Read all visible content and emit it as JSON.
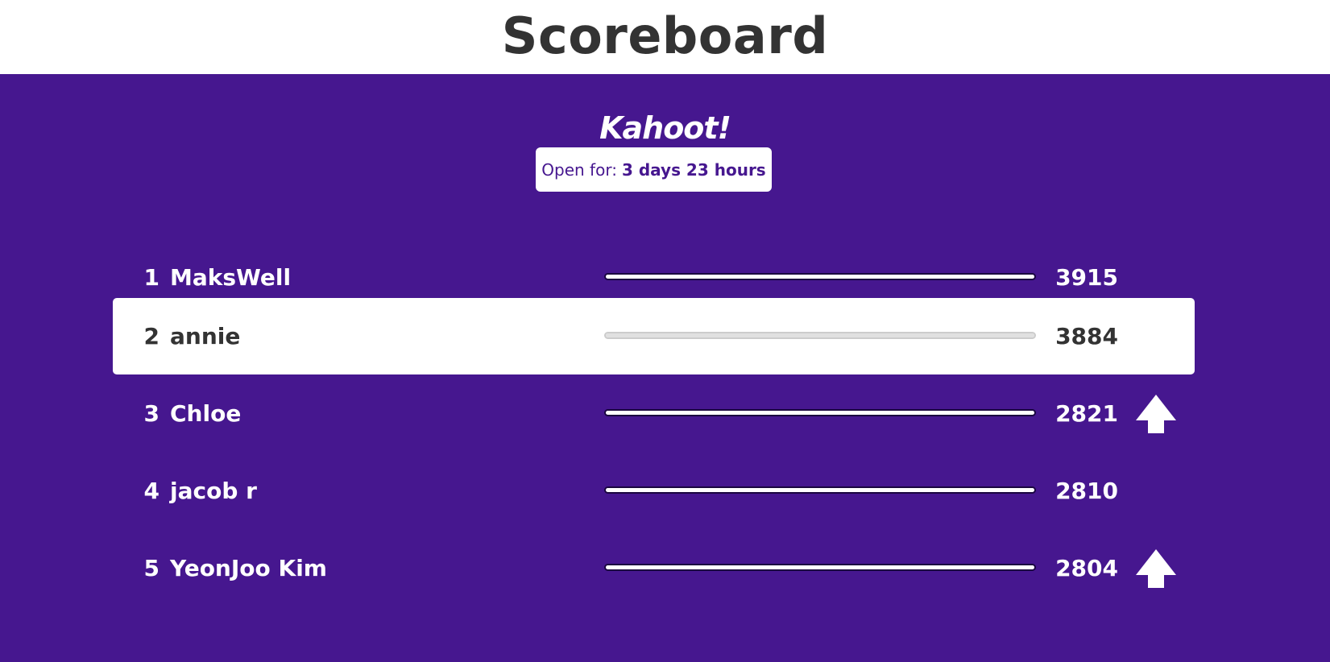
{
  "header": {
    "title": "Scoreboard"
  },
  "logo": {
    "text": "Kahoot!"
  },
  "timer": {
    "label": "Open for:",
    "value": "3 days 23 hours"
  },
  "scoreboard": {
    "rows": [
      {
        "rank": "1",
        "name": "MaksWell",
        "score": "3915",
        "progress": 1.0,
        "highlight": false,
        "arrow_up": false
      },
      {
        "rank": "2",
        "name": "annie",
        "score": "3884",
        "progress": 1.0,
        "highlight": true,
        "arrow_up": false
      },
      {
        "rank": "3",
        "name": "Chloe",
        "score": "2821",
        "progress": 1.0,
        "highlight": false,
        "arrow_up": true
      },
      {
        "rank": "4",
        "name": "jacob r",
        "score": "2810",
        "progress": 1.0,
        "highlight": false,
        "arrow_up": false
      },
      {
        "rank": "5",
        "name": "YeonJoo Kim",
        "score": "2804",
        "progress": 1.0,
        "highlight": false,
        "arrow_up": true
      }
    ]
  },
  "colors": {
    "background": "#46178f",
    "header_background": "#ffffff",
    "title_text": "#333333"
  }
}
